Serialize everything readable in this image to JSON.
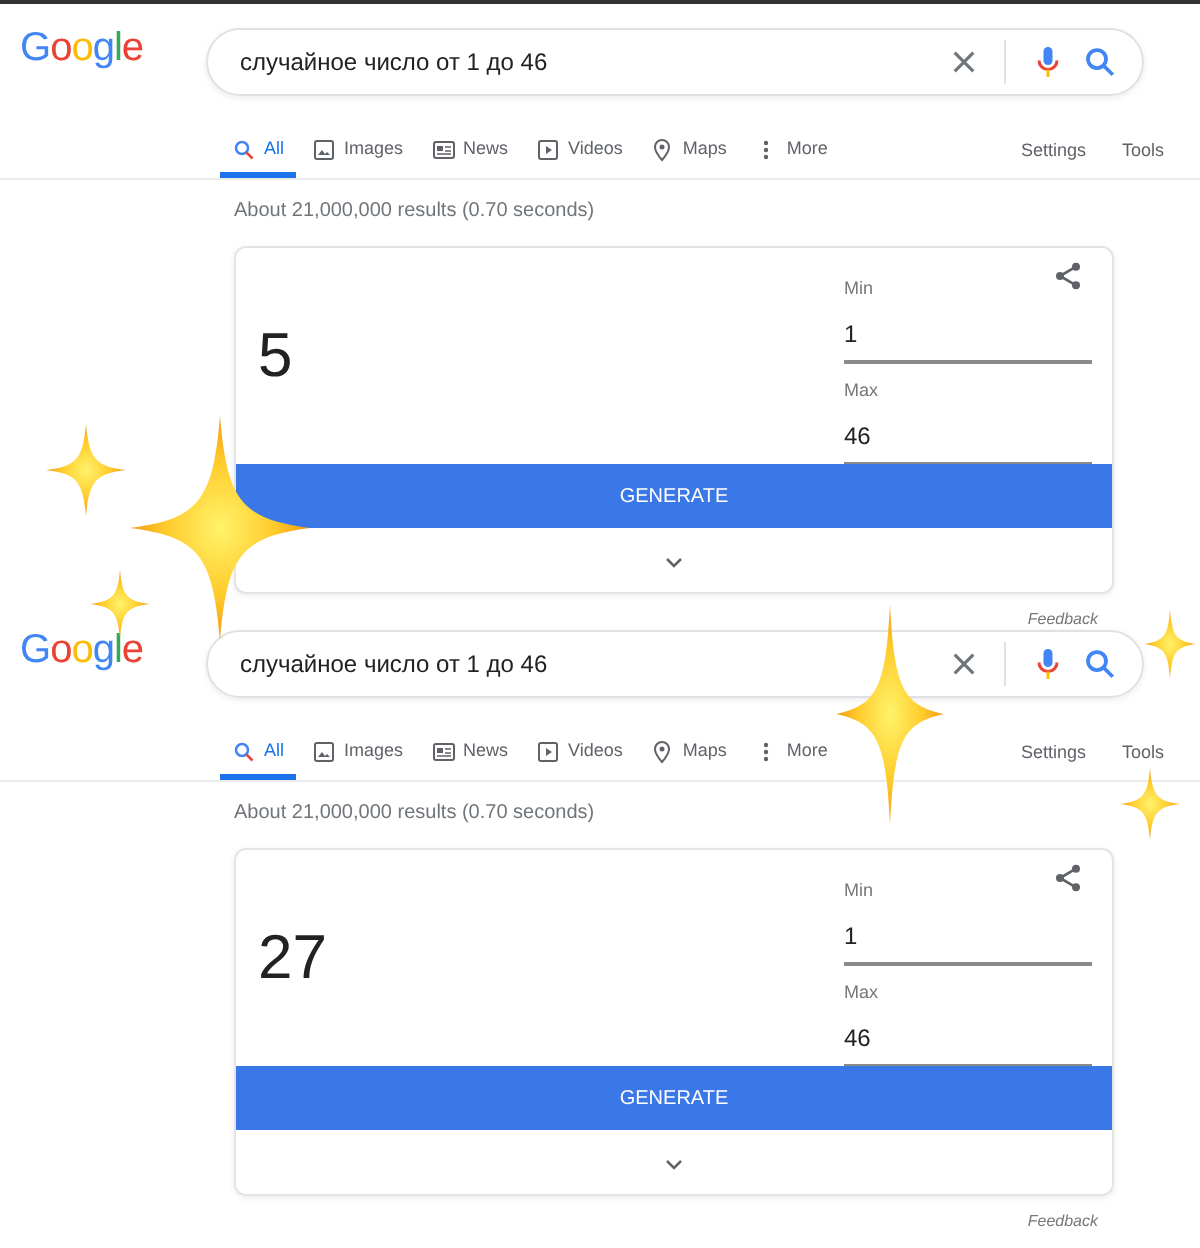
{
  "panels": [
    {
      "logo": "Google",
      "search": {
        "value": "случайное число от 1 до 46"
      },
      "tabs": [
        {
          "label": "All",
          "kind": "search",
          "selected": true
        },
        {
          "label": "Images",
          "kind": "image",
          "selected": false
        },
        {
          "label": "News",
          "kind": "news",
          "selected": false
        },
        {
          "label": "Videos",
          "kind": "video",
          "selected": false
        },
        {
          "label": "Maps",
          "kind": "map",
          "selected": false
        },
        {
          "label": "More",
          "kind": "more",
          "selected": false
        }
      ],
      "tools": [
        "Settings",
        "Tools"
      ],
      "result_stats": "About 21,000,000 results (0.70 seconds)",
      "generator": {
        "result": "5",
        "min_label": "Min",
        "min": "1",
        "max_label": "Max",
        "max": "46",
        "button": "GENERATE"
      },
      "feedback": "Feedback"
    },
    {
      "logo": "Google",
      "search": {
        "value": "случайное число от 1 до 46"
      },
      "tabs": [
        {
          "label": "All",
          "kind": "search",
          "selected": true
        },
        {
          "label": "Images",
          "kind": "image",
          "selected": false
        },
        {
          "label": "News",
          "kind": "news",
          "selected": false
        },
        {
          "label": "Videos",
          "kind": "video",
          "selected": false
        },
        {
          "label": "Maps",
          "kind": "map",
          "selected": false
        },
        {
          "label": "More",
          "kind": "more",
          "selected": false
        }
      ],
      "tools": [
        "Settings",
        "Tools"
      ],
      "result_stats": "About 21,000,000 results (0.70 seconds)",
      "generator": {
        "result": "27",
        "min_label": "Min",
        "min": "1",
        "max_label": "Max",
        "max": "46",
        "button": "GENERATE"
      },
      "feedback": "Feedback"
    }
  ]
}
